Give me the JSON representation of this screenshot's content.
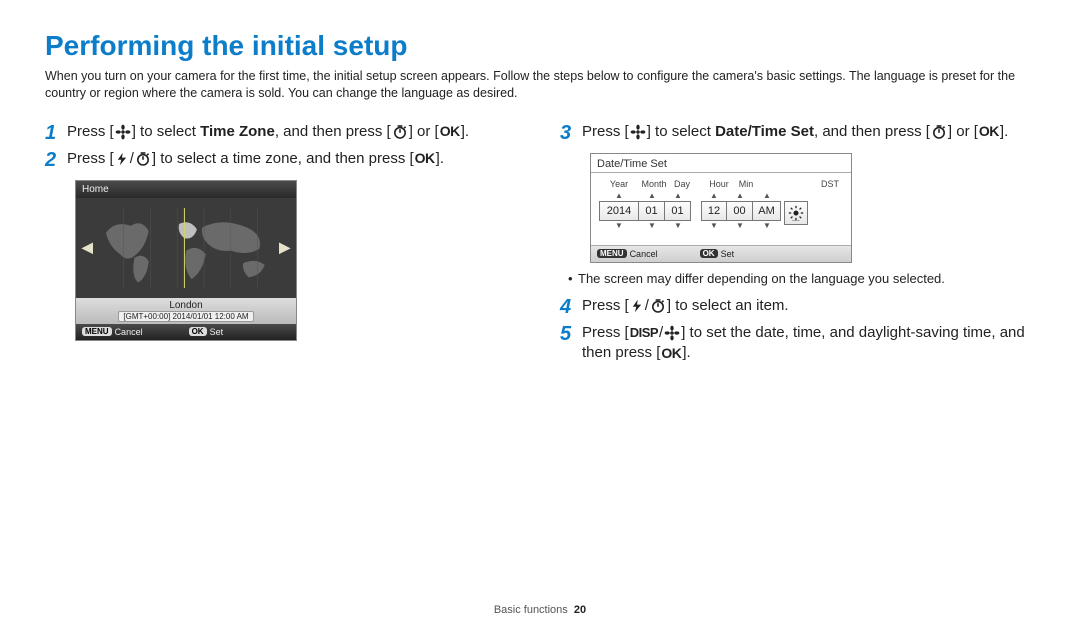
{
  "title": "Performing the initial setup",
  "intro": "When you turn on your camera for the first time, the initial setup screen appears. Follow the steps below to configure the camera's basic settings. The language is preset for the country or region where the camera is sold. You can change the language as desired.",
  "left": {
    "step1_a": "Press [",
    "step1_b": "] to select ",
    "step1_bold": "Time Zone",
    "step1_c": ", and then press [",
    "step1_d": "] or [",
    "step1_e": "].",
    "step2_a": "Press [",
    "step2_b": "] to select a time zone, and then press [",
    "step2_c": "]."
  },
  "right": {
    "step3_a": "Press [",
    "step3_b": "] to select ",
    "step3_bold": "Date/Time Set",
    "step3_c": ", and then press [",
    "step3_d": "] or [",
    "step3_e": "].",
    "note": "The screen may differ depending on the language you selected.",
    "step4_a": "Press [",
    "step4_b": "] to select an item.",
    "step5_a": "Press [",
    "step5_b": "] to set the date, time, and daylight-saving time, and then press [",
    "step5_c": "]."
  },
  "tz_screen": {
    "title": "Home",
    "city": "London",
    "gmt": "[GMT+00:00] 2014/01/01 12:00 AM",
    "cancel_btn": "MENU",
    "cancel": "Cancel",
    "set_btn": "OK",
    "set": "Set"
  },
  "dt_screen": {
    "title": "Date/Time Set",
    "lbl_year": "Year",
    "lbl_month": "Month",
    "lbl_day": "Day",
    "lbl_hour": "Hour",
    "lbl_min": "Min",
    "lbl_dst": "DST",
    "year": "2014",
    "month": "01",
    "day": "01",
    "hour": "12",
    "min": "00",
    "ampm": "AM",
    "cancel_btn": "MENU",
    "cancel": "Cancel",
    "set_btn": "OK",
    "set": "Set"
  },
  "footer_section": "Basic functions",
  "footer_page": "20"
}
